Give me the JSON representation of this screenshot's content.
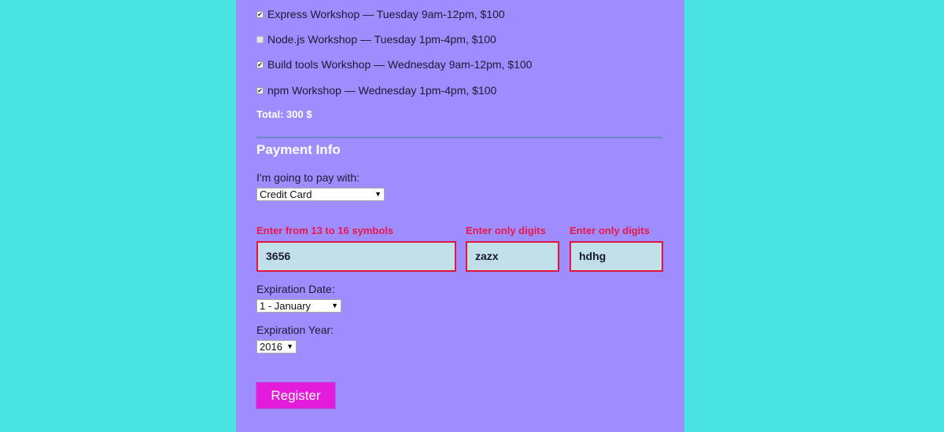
{
  "activities": [
    {
      "label": "Express Workshop — Tuesday 9am-12pm, $100",
      "checked": true
    },
    {
      "label": "Node.js Workshop — Tuesday 1pm-4pm, $100",
      "checked": false
    },
    {
      "label": "Build tools Workshop — Wednesday 9am-12pm, $100",
      "checked": true
    },
    {
      "label": "npm Workshop — Wednesday 1pm-4pm, $100",
      "checked": true
    }
  ],
  "total": "Total: 300 $",
  "payment": {
    "title": "Payment Info",
    "pay_label": "I'm going to pay with:",
    "pay_value": "Credit Card",
    "card_error": "Enter from 13 to 16 symbols",
    "card_value": "3656",
    "zip_error": "Enter only digits",
    "zip_value": "zazx",
    "cvv_error": "Enter only digits",
    "cvv_value": "hdhg",
    "exp_date_label": "Expiration Date:",
    "exp_date_value": "1 - January",
    "exp_year_label": "Expiration Year:",
    "exp_year_value": "2016"
  },
  "register_label": "Register",
  "colors": {
    "background": "#48e3e2",
    "panel": "#9f8dfe",
    "error": "#e8184a",
    "button": "#e31bdb"
  }
}
